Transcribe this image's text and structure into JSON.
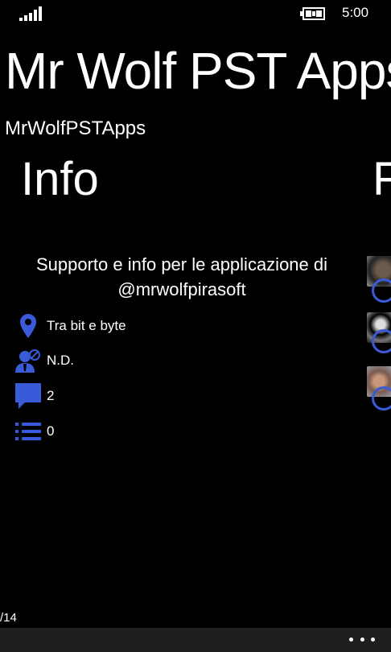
{
  "status": {
    "time": "5:00"
  },
  "header": {
    "title": "Mr Wolf PST Apps",
    "subtitle": "MrWolfPSTApps"
  },
  "pivot": {
    "active": "Info",
    "next": "F"
  },
  "info": {
    "description": "Supporto e info per le applicazione di @mrwolfpirasoft",
    "location": "Tra bit e byte",
    "gender": "N.D.",
    "messages": "2",
    "lists": "0"
  },
  "footer": {
    "page": "/14"
  },
  "colors": {
    "accent": "#3a5bd9",
    "background": "#000000",
    "appbar": "#1f1f1f"
  }
}
